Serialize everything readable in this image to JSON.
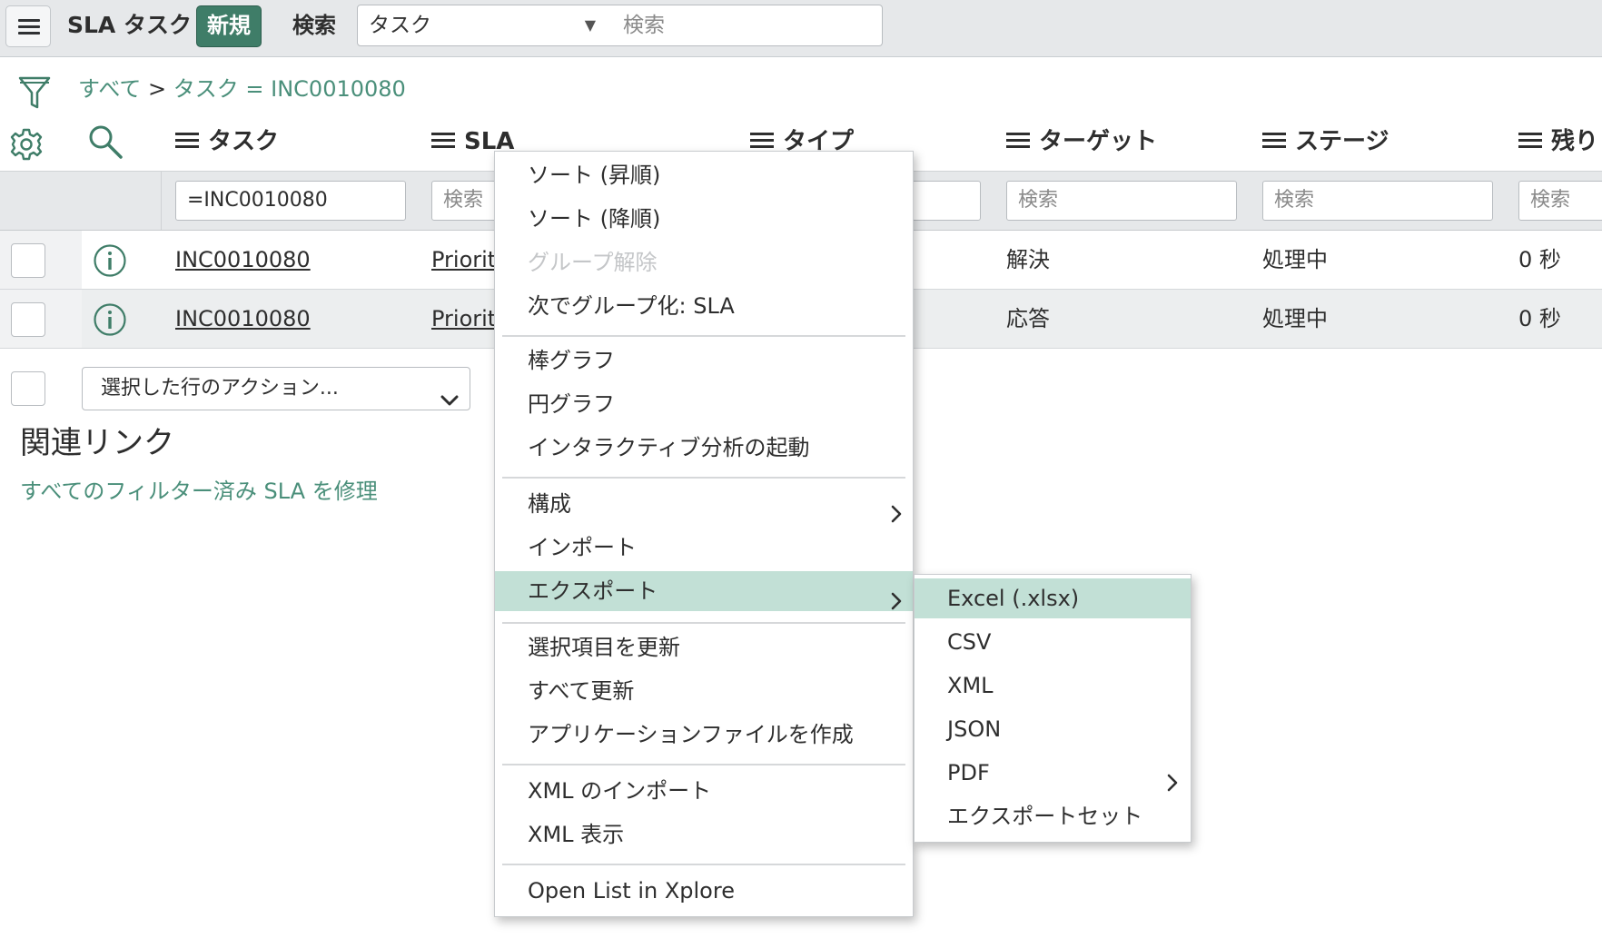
{
  "header": {
    "menu_icon": "hamburger-icon",
    "title": "SLA タスク",
    "new_label": "新規",
    "search_label": "検索",
    "search_field": "タスク",
    "search_placeholder": "検索"
  },
  "breadcrumb": {
    "all": "すべて",
    "separator": ">",
    "filter": "タスク = INC0010080"
  },
  "columns": [
    "タスク",
    "SLA",
    "タイプ",
    "ターゲット",
    "ステージ",
    "残り"
  ],
  "filters": {
    "task": "=INC0010080",
    "placeholder": "検索"
  },
  "rows": [
    {
      "task": "INC0010080",
      "sla": "Priorit",
      "target": "解決",
      "stage": "処理中",
      "remaining": "0 秒"
    },
    {
      "task": "INC0010080",
      "sla": "Priorit",
      "target": "応答",
      "stage": "処理中",
      "remaining": "0 秒"
    }
  ],
  "actions_select": "選択した行のアクション...",
  "related": {
    "title": "関連リンク",
    "link": "すべてのフィルター済み SLA を修理"
  },
  "context_menu": [
    "ソート (昇順)",
    "ソート (降順)",
    "グループ解除",
    "次でグループ化: SLA",
    "棒グラフ",
    "円グラフ",
    "インタラクティブ分析の起動",
    "構成",
    "インポート",
    "エクスポート",
    "選択項目を更新",
    "すべて更新",
    "アプリケーションファイルを作成",
    "XML のインポート",
    "XML 表示",
    "Open List in Xplore"
  ],
  "export_submenu": [
    "Excel (.xlsx)",
    "CSV",
    "XML",
    "JSON",
    "PDF",
    "エクスポートセット"
  ],
  "colors": {
    "accent": "#3f7d68",
    "link": "#4a8f7a",
    "highlight": "#c2e0d6",
    "header_bg": "#e6e8ea"
  }
}
